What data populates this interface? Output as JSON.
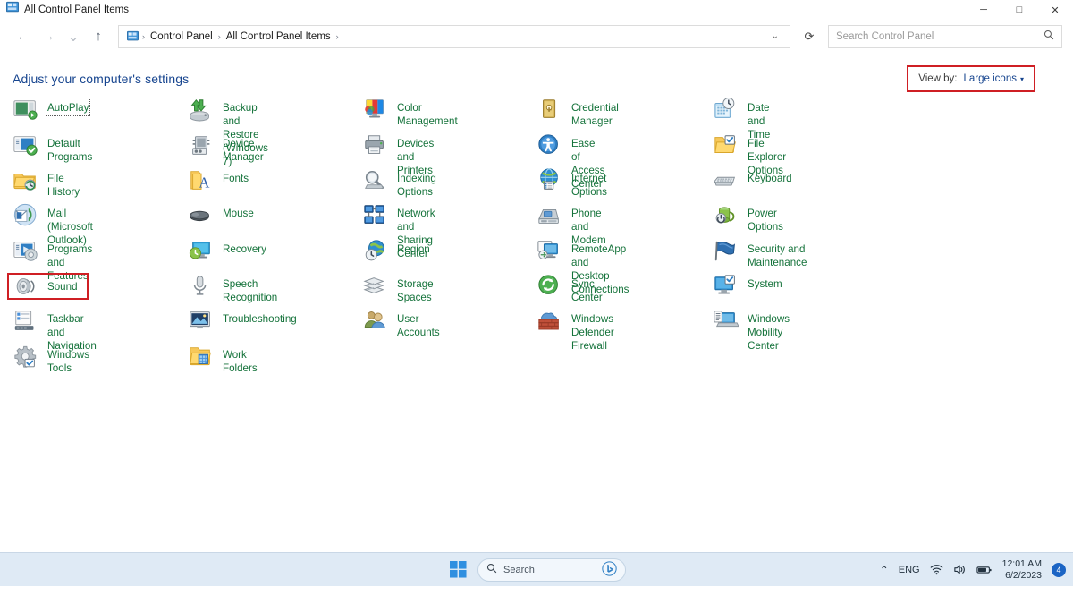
{
  "window": {
    "title": "All Control Panel Items",
    "app_icon": "control-panel-icon",
    "minimize_label": "─",
    "maximize_label": "□",
    "close_label": "✕"
  },
  "nav": {
    "back_label": "←",
    "forward_label": "→",
    "recent_label": "⌄",
    "up_label": "↑",
    "breadcrumbs": [
      "Control Panel",
      "All Control Panel Items"
    ],
    "separator": "›",
    "dropdown_caret": "⌄",
    "refresh_label": "⟳"
  },
  "search": {
    "placeholder": "Search Control Panel",
    "icon": "search-icon"
  },
  "header": {
    "heading": "Adjust your computer's settings",
    "view_by_label": "View by:",
    "view_by_value": "Large icons",
    "view_by_caret": "▾"
  },
  "colors": {
    "accent_heading": "#17458f",
    "item_label": "#14723a",
    "annotation_box": "#cf1f24",
    "taskbar": "#dfeaf5"
  },
  "columns": [
    {
      "items": [
        {
          "label": "AutoPlay",
          "icon": "autoplay-icon",
          "focused": true
        },
        {
          "label": "Default Programs",
          "icon": "default-programs-icon"
        },
        {
          "label": "File History",
          "icon": "file-history-icon"
        },
        {
          "label": "Mail (Microsoft Outlook)",
          "icon": "mail-icon"
        },
        {
          "label": "Programs and Features",
          "icon": "programs-and-features-icon"
        },
        {
          "label": "Sound",
          "icon": "sound-icon",
          "boxed": true
        },
        {
          "label": "Taskbar and Navigation",
          "icon": "taskbar-and-navigation-icon"
        },
        {
          "label": "Windows Tools",
          "icon": "windows-tools-icon"
        }
      ]
    },
    {
      "items": [
        {
          "label": "Backup and Restore (Windows 7)",
          "icon": "backup-and-restore-icon"
        },
        {
          "label": "Device Manager",
          "icon": "device-manager-icon"
        },
        {
          "label": "Fonts",
          "icon": "fonts-icon"
        },
        {
          "label": "Mouse",
          "icon": "mouse-icon"
        },
        {
          "label": "Recovery",
          "icon": "recovery-icon"
        },
        {
          "label": "Speech Recognition",
          "icon": "speech-recognition-icon"
        },
        {
          "label": "Troubleshooting",
          "icon": "troubleshooting-icon"
        },
        {
          "label": "Work Folders",
          "icon": "work-folders-icon"
        }
      ]
    },
    {
      "items": [
        {
          "label": "Color Management",
          "icon": "color-management-icon"
        },
        {
          "label": "Devices and Printers",
          "icon": "devices-and-printers-icon"
        },
        {
          "label": "Indexing Options",
          "icon": "indexing-options-icon"
        },
        {
          "label": "Network and Sharing Center",
          "icon": "network-and-sharing-center-icon"
        },
        {
          "label": "Region",
          "icon": "region-icon"
        },
        {
          "label": "Storage Spaces",
          "icon": "storage-spaces-icon"
        },
        {
          "label": "User Accounts",
          "icon": "user-accounts-icon"
        }
      ]
    },
    {
      "items": [
        {
          "label": "Credential Manager",
          "icon": "credential-manager-icon"
        },
        {
          "label": "Ease of Access Center",
          "icon": "ease-of-access-center-icon"
        },
        {
          "label": "Internet Options",
          "icon": "internet-options-icon"
        },
        {
          "label": "Phone and Modem",
          "icon": "phone-and-modem-icon"
        },
        {
          "label": "RemoteApp and Desktop Connections",
          "icon": "remoteapp-and-desktop-connections-icon"
        },
        {
          "label": "Sync Center",
          "icon": "sync-center-icon"
        },
        {
          "label": "Windows Defender Firewall",
          "icon": "windows-defender-firewall-icon"
        }
      ]
    },
    {
      "items": [
        {
          "label": "Date and Time",
          "icon": "date-and-time-icon"
        },
        {
          "label": "File Explorer Options",
          "icon": "file-explorer-options-icon"
        },
        {
          "label": "Keyboard",
          "icon": "keyboard-icon"
        },
        {
          "label": "Power Options",
          "icon": "power-options-icon"
        },
        {
          "label": "Security and Maintenance",
          "icon": "security-and-maintenance-icon"
        },
        {
          "label": "System",
          "icon": "system-icon"
        },
        {
          "label": "Windows Mobility Center",
          "icon": "windows-mobility-center-icon"
        }
      ]
    }
  ],
  "taskbar": {
    "start_icon": "windows-start-icon",
    "search_placeholder": "Search",
    "search_icon": "search-icon",
    "bing_icon": "bing-chat-icon",
    "tray_chevron": "⌃",
    "language": "ENG",
    "wifi_icon": "wifi-icon",
    "volume_icon": "volume-icon",
    "battery_icon": "battery-icon",
    "time": "12:01 AM",
    "date": "6/2/2023",
    "notification_count": "4"
  }
}
